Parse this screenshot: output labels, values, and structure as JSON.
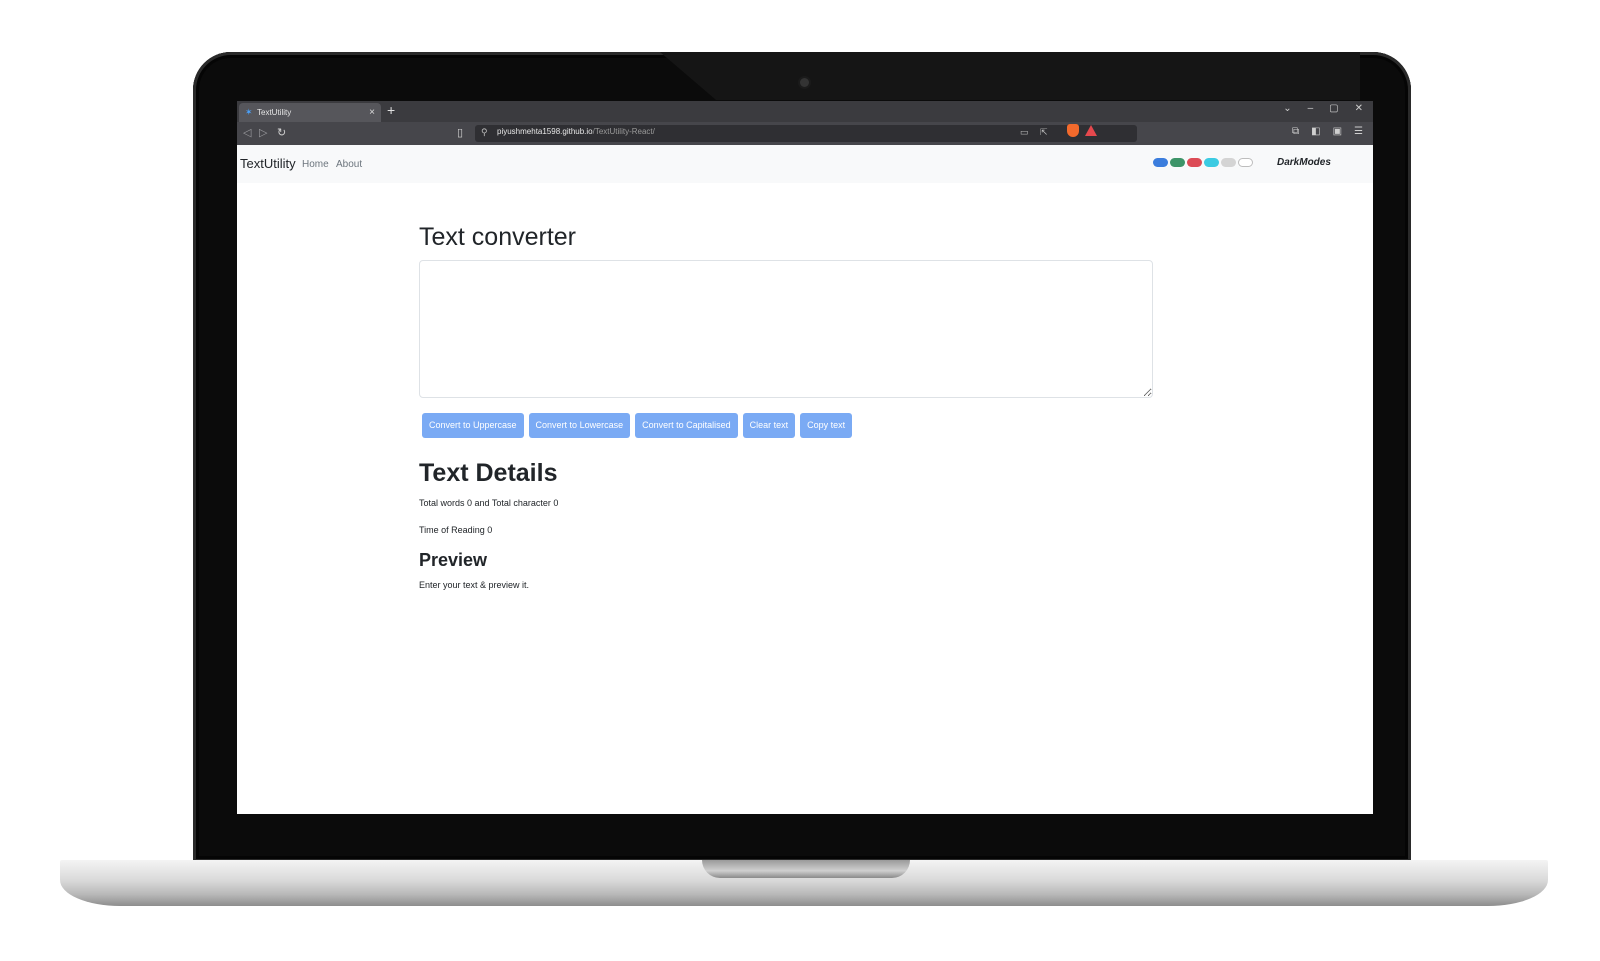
{
  "browser": {
    "tab_title": "TextUtility",
    "tab_close": "×",
    "new_tab": "+",
    "url_host": "piyushmehta1598.github.io",
    "url_path": "/TextUtility-React/",
    "window_controls": [
      "⌄",
      "–",
      "▢",
      "✕"
    ]
  },
  "navbar": {
    "brand": "TextUtility",
    "links": [
      "Home",
      "About"
    ],
    "theme_swatches": [
      "#0d6efd",
      "#198754",
      "#dc3545",
      "#0dcaf0",
      "#d3d3d3",
      "#ffffff"
    ],
    "darkmodes_label": "DarkModes"
  },
  "main": {
    "title": "Text converter",
    "textarea_value": "",
    "buttons": [
      "Convert to Uppercase",
      "Convert to Lowercase",
      "Convert to Capitalised",
      "Clear text",
      "Copy text"
    ],
    "details_title": "Text Details",
    "word_count_text": "Total words 0 and Total character 0",
    "reading_time_text": "Time of Reading 0",
    "preview_title": "Preview",
    "preview_text": "Enter your text & preview it."
  },
  "colors": {
    "button_bg": "#7aaaf4",
    "navbar_bg": "#f8f9fa"
  }
}
